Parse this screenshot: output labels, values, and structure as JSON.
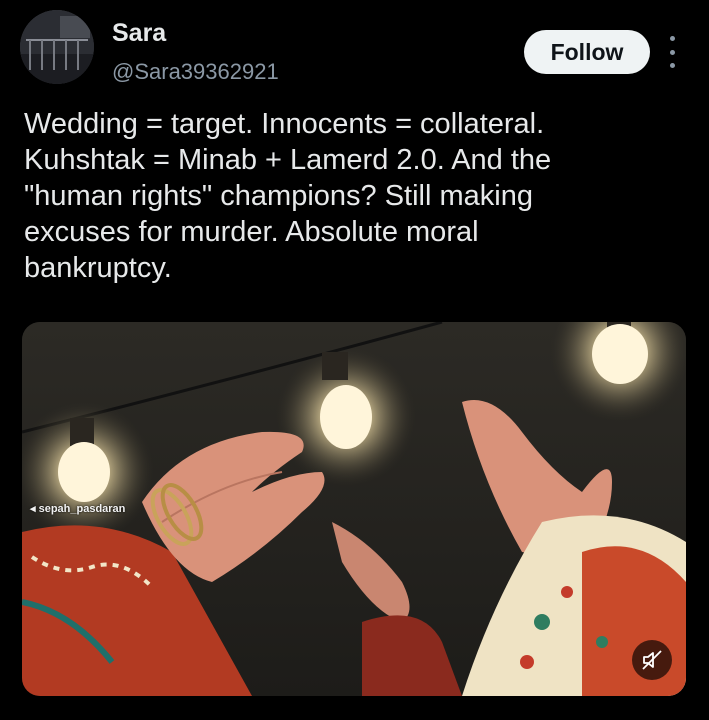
{
  "author": {
    "display_name": "Sara",
    "handle": "@Sara39362921",
    "avatar_icon": "avatar-photo"
  },
  "actions": {
    "follow_label": "Follow",
    "more_icon": "more-vertical-icon"
  },
  "tweet": {
    "text": "Wedding = target. Innocents = collateral.\nKuhshtak = Minab + Lamerd 2.0. And the\n\"human rights\" champions? Still making\nexcuses for murder. Absolute moral\nbankruptcy."
  },
  "media": {
    "watermark": "sepah_pasdaran",
    "mute_icon": "speaker-muted-icon"
  },
  "colors": {
    "background": "#000000",
    "text_primary": "#e7e9ea",
    "text_secondary": "#8b98a5",
    "follow_bg": "#eff3f4"
  }
}
